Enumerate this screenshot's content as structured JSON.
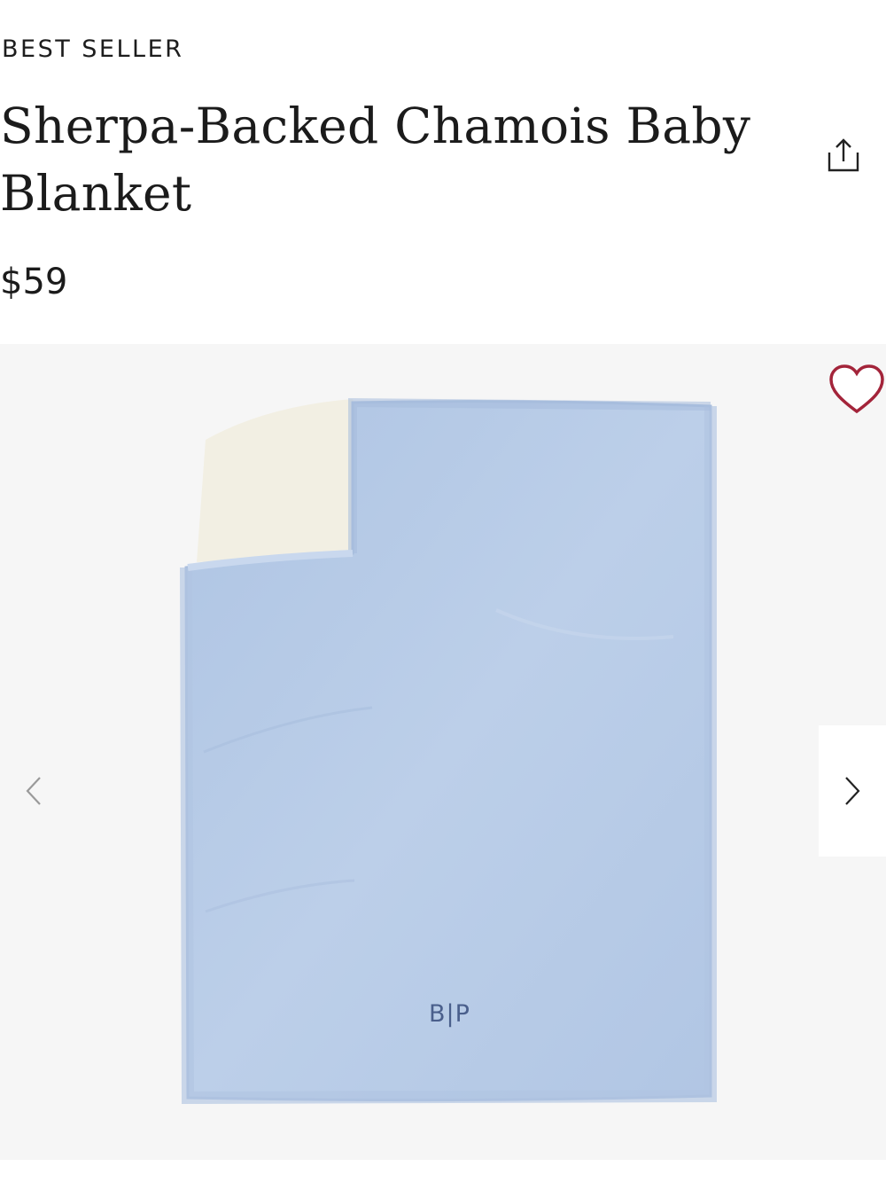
{
  "product": {
    "badge": "BEST SELLER",
    "title": "Sherpa-Backed Chamois Baby Blanket",
    "price": "$59",
    "monogram": "B|P"
  },
  "icons": {
    "share": "share-icon",
    "favorite": "heart-icon",
    "prev": "chevron-left-icon",
    "next": "chevron-right-icon"
  },
  "colors": {
    "favorite": "#a3243a",
    "blanket": "#b7cbe6",
    "sherpa": "#f3f0e4",
    "gallery_bg": "#f6f6f6"
  }
}
